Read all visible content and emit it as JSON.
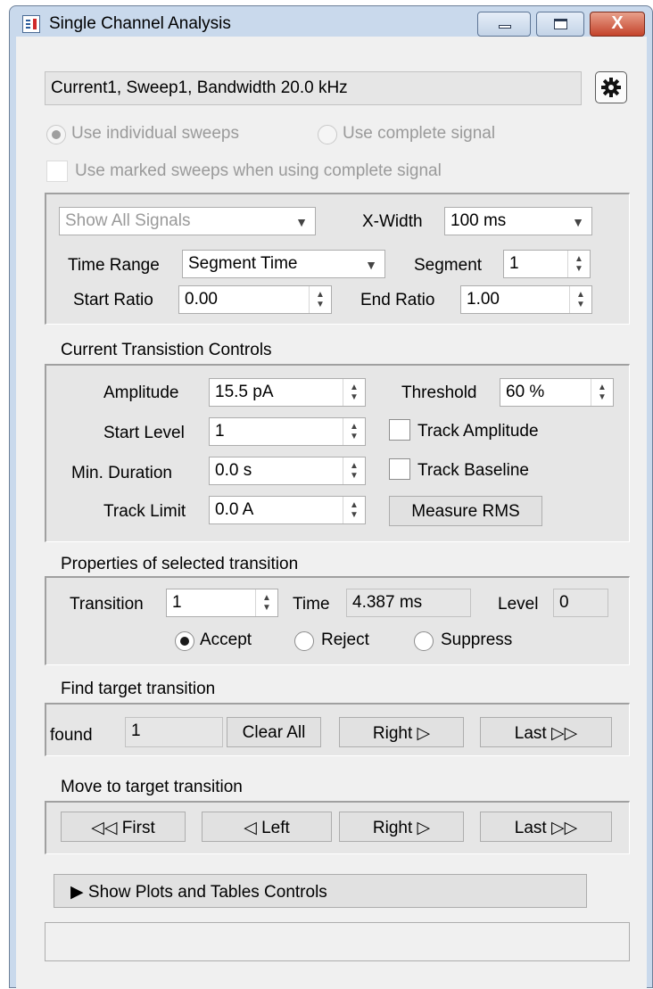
{
  "window": {
    "title": "Single Channel Analysis",
    "icons": {
      "app": "app-icon",
      "minimize": "minimize-icon",
      "maximize": "maximize-icon",
      "close": "close-icon"
    },
    "close_glyph": "X"
  },
  "info_text": "Current1, Sweep1, Bandwidth 20.0 kHz",
  "settings_icon": "gear-icon",
  "mode": {
    "individual_label": "Use individual sweeps",
    "complete_label": "Use complete signal",
    "marked_label": "Use marked sweeps when using complete signal",
    "selected": "individual"
  },
  "display": {
    "show_signals": "Show All Signals",
    "xwidth_label": "X-Width",
    "xwidth_value": "100 ms",
    "time_range_label": "Time Range",
    "time_range_value": "Segment Time",
    "segment_label": "Segment",
    "segment_value": "1",
    "start_ratio_label": "Start Ratio",
    "start_ratio_value": "0.00",
    "end_ratio_label": "End Ratio",
    "end_ratio_value": "1.00"
  },
  "transition_controls": {
    "heading": "Current Transistion Controls",
    "amplitude_label": "Amplitude",
    "amplitude_value": "15.5 pA",
    "threshold_label": "Threshold",
    "threshold_value": "60 %",
    "start_level_label": "Start Level",
    "start_level_value": "1",
    "track_amplitude_label": "Track Amplitude",
    "min_duration_label": "Min. Duration",
    "min_duration_value": "0.0 s",
    "track_baseline_label": "Track Baseline",
    "track_limit_label": "Track Limit",
    "track_limit_value": "0.0 A",
    "measure_rms_label": "Measure RMS"
  },
  "properties": {
    "heading": "Properties of selected transition",
    "transition_label": "Transition",
    "transition_value": "1",
    "time_label": "Time",
    "time_value": "4.387 ms",
    "level_label": "Level",
    "level_value": "0",
    "accept_label": "Accept",
    "reject_label": "Reject",
    "suppress_label": "Suppress",
    "selected": "accept"
  },
  "find": {
    "heading": "Find target transition",
    "found_label": "found",
    "found_value": "1",
    "clear_all_label": "Clear All",
    "right_label": "Right  ▷",
    "last_label": "Last  ▷▷"
  },
  "move": {
    "heading": "Move to target transition",
    "first_label": "◁◁  First",
    "left_label": "◁  Left",
    "right_label": "Right  ▷",
    "last_label": "Last  ▷▷"
  },
  "plots_toggle_label": "▶  Show Plots and Tables Controls",
  "status_text": ""
}
